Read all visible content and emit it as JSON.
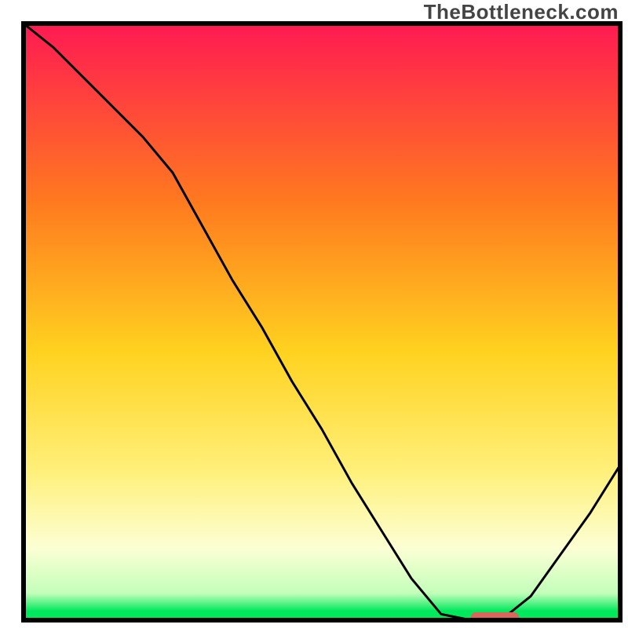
{
  "watermark": "TheBottleneck.com",
  "chart_data": {
    "type": "line",
    "title": "",
    "xlabel": "",
    "ylabel": "",
    "xlim": [
      0,
      100
    ],
    "ylim": [
      0,
      100
    ],
    "note": "Axes are unlabeled; values are read as percentage of plot width/height. y=0 at bottom (green), y=100 at top (red). The curve depicts a bottleneck metric that drops from ~100 at the left edge to ~0 near x≈80, stays at 0 briefly, then rises toward the right edge.",
    "series": [
      {
        "name": "bottleneck-curve",
        "x": [
          0,
          5,
          10,
          15,
          20,
          25,
          30,
          35,
          40,
          45,
          50,
          55,
          60,
          65,
          70,
          75,
          80,
          85,
          90,
          95,
          100
        ],
        "y": [
          100,
          96,
          91,
          86,
          81,
          75,
          66,
          57,
          49,
          40,
          32,
          23,
          15,
          7,
          1,
          0,
          0,
          4,
          11,
          18,
          26
        ]
      }
    ],
    "marker": {
      "name": "optimal-zone-marker",
      "x_start": 75,
      "x_end": 83,
      "y": 0,
      "color": "#d9655b"
    },
    "gradient_stops": [
      {
        "offset": 0.0,
        "color": "#ff1a52"
      },
      {
        "offset": 0.3,
        "color": "#ff7a1f"
      },
      {
        "offset": 0.55,
        "color": "#ffd21f"
      },
      {
        "offset": 0.75,
        "color": "#fff07a"
      },
      {
        "offset": 0.88,
        "color": "#fcffd4"
      },
      {
        "offset": 0.955,
        "color": "#c3ffba"
      },
      {
        "offset": 0.985,
        "color": "#00e85c"
      },
      {
        "offset": 1.0,
        "color": "#00e85c"
      }
    ],
    "border_color": "#000000",
    "curve_color": "#000000"
  }
}
